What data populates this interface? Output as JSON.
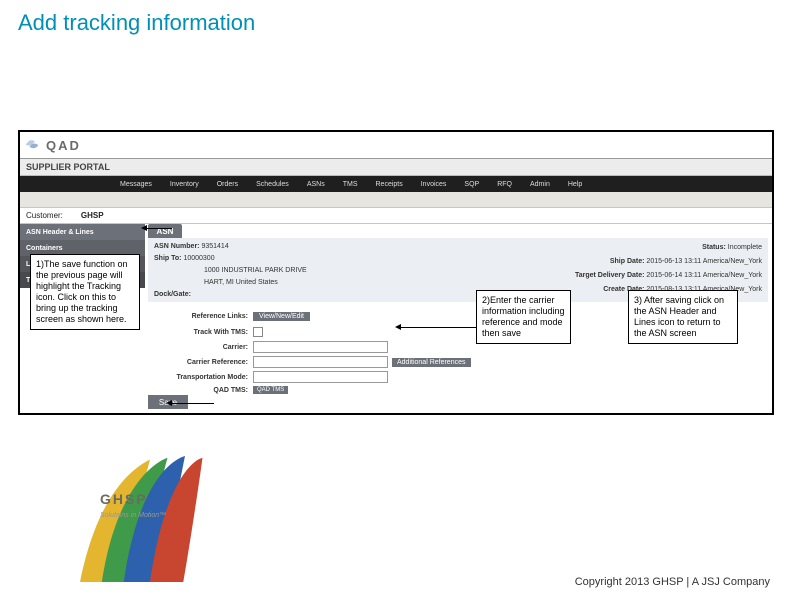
{
  "slide": {
    "title": "Add tracking information"
  },
  "qad": {
    "wordmark": "QAD",
    "portal": "SUPPLIER PORTAL"
  },
  "menu": [
    "Messages",
    "Inventory",
    "Orders",
    "Schedules",
    "ASNs",
    "TMS",
    "Receipts",
    "Invoices",
    "SQP",
    "RFQ",
    "Admin",
    "Help"
  ],
  "customer": {
    "label": "Customer:",
    "value": "GHSP"
  },
  "sidenav": {
    "header": "ASN Header & Lines",
    "containers": "Containers",
    "labels": "Labels",
    "tracking": "Tracking"
  },
  "asn_tab": "ASN",
  "asn": {
    "number_lbl": "ASN Number:",
    "number": "9351414",
    "shipto_lbl": "Ship To:",
    "shipto": "10000300",
    "addr1": "1000 INDUSTRIAL PARK DRIVE",
    "addr2": "HART, MI United States",
    "dock_lbl": "Dock/Gate:",
    "status_lbl": "Status:",
    "status": "Incomplete",
    "shipdate_lbl": "Ship Date:",
    "shipdate": "2015-06-13 13:11 America/New_York",
    "target_lbl": "Target Delivery Date:",
    "target": "2015-06-14 13:11 America/New_York",
    "createdate_lbl": "Create Date:",
    "createdate": "2015-08-13 13:11 America/New_York"
  },
  "form": {
    "reflinks_lbl": "Reference Links:",
    "vne_btn": "View/New/Edit",
    "tms_lbl": "Track With TMS:",
    "carrier_lbl": "Carrier:",
    "carrierref_lbl": "Carrier Reference:",
    "addref_btn": "Additional References",
    "mode_lbl": "Transportation Mode:",
    "qadtms_lbl": "QAD TMS:",
    "qadtms_btn": "QAD TMS",
    "save_btn": "Save"
  },
  "callouts": {
    "c1": "1)The save function on the previous page will highlight the Tracking icon. Click on this to bring up the tracking screen as shown here.",
    "c2": "2)Enter the carrier information including reference and mode then save",
    "c3": "3) After saving click on the ASN Header and Lines icon to return to the ASN screen"
  },
  "footer": {
    "brand": "GHSP",
    "tagline": "Solutions in Motion™",
    "copyright": "Copyright 2013 GHSP  |   A JSJ Company"
  }
}
